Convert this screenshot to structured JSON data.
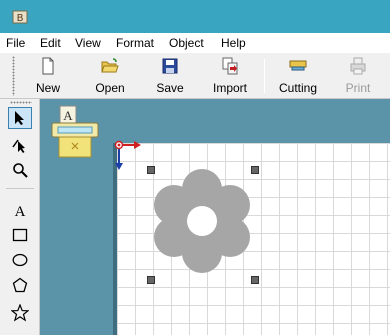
{
  "menu": [
    "File",
    "Edit",
    "View",
    "Format",
    "Object",
    "Help"
  ],
  "toolbar": {
    "buttons": [
      {
        "label": "New",
        "icon": "new-document-icon",
        "enabled": true
      },
      {
        "label": "Open",
        "icon": "open-folder-icon",
        "enabled": true
      },
      {
        "label": "Save",
        "icon": "save-disk-icon",
        "enabled": true
      },
      {
        "label": "Import",
        "icon": "import-icon",
        "enabled": true
      },
      {
        "label": "Cutting",
        "icon": "cutter-icon",
        "enabled": true
      },
      {
        "label": "Print",
        "icon": "printer-icon",
        "enabled": false
      }
    ]
  },
  "toolbox": {
    "tools": [
      "select-arrow-icon",
      "node-edit-icon",
      "zoom-icon",
      "text-tool-icon",
      "rectangle-icon",
      "ellipse-icon",
      "pentagon-icon",
      "star-icon"
    ],
    "active": "select-arrow-icon"
  },
  "canvas": {
    "cutter_label": "A",
    "shape": "flower",
    "shape_color": "#a6a6a6",
    "origin_x_color": "#d02020",
    "origin_y_color": "#1a3fa8"
  },
  "colors": {
    "titlebar": "#3aa5c0",
    "workspace": "#5b93a8",
    "tool_active": "#cce4f7"
  }
}
